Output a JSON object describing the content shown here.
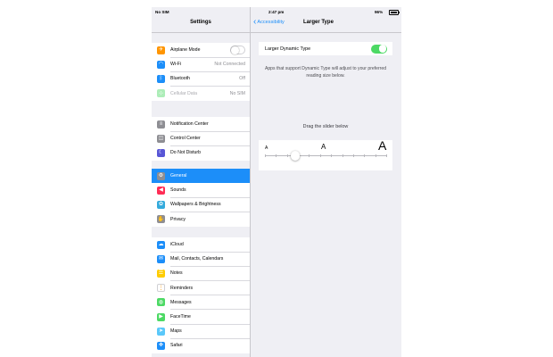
{
  "status_bar": {
    "carrier": "No SIM",
    "time": "2:47 pm",
    "battery": "96%"
  },
  "sidebar": {
    "title": "Settings",
    "groups": [
      [
        {
          "label": "Airplane Mode",
          "icon": "airplane-icon",
          "color": "#ff9500",
          "glyph": "✈",
          "toggle": false
        },
        {
          "label": "Wi-Fi",
          "value": "Not Connected",
          "icon": "wifi-icon",
          "color": "#1c8ef9",
          "glyph": "◠"
        },
        {
          "label": "Bluetooth",
          "value": "Off",
          "icon": "bluetooth-icon",
          "color": "#1c8ef9",
          "glyph": "ᛒ"
        },
        {
          "label": "Cellular Data",
          "value": "No SIM",
          "icon": "cellular-icon",
          "color": "#4cd964",
          "glyph": "⊹",
          "disabled": true
        }
      ],
      [
        {
          "label": "Notification Center",
          "icon": "notification-center-icon",
          "color": "#8e8e93",
          "glyph": "≡"
        },
        {
          "label": "Control Center",
          "icon": "control-center-icon",
          "color": "#8e8e93",
          "glyph": "◫"
        },
        {
          "label": "Do Not Disturb",
          "icon": "moon-icon",
          "color": "#5856d6",
          "glyph": "☾"
        }
      ],
      [
        {
          "label": "General",
          "icon": "gear-icon",
          "color": "#8e8e93",
          "glyph": "⚙",
          "selected": true
        },
        {
          "label": "Sounds",
          "icon": "speaker-icon",
          "color": "#ff2d55",
          "glyph": "◀"
        },
        {
          "label": "Wallpapers & Brightness",
          "icon": "flower-icon",
          "color": "#34aadc",
          "glyph": "✿"
        },
        {
          "label": "Privacy",
          "icon": "hand-icon",
          "color": "#8e8e93",
          "glyph": "✋"
        }
      ],
      [
        {
          "label": "iCloud",
          "icon": "cloud-icon",
          "color": "#1c8ef9",
          "glyph": "☁"
        },
        {
          "label": "Mail, Contacts, Calendars",
          "icon": "mail-icon",
          "color": "#1c8ef9",
          "glyph": "✉"
        },
        {
          "label": "Notes",
          "icon": "notes-icon",
          "color": "#ffcc00",
          "glyph": "☰"
        },
        {
          "label": "Reminders",
          "icon": "reminders-icon",
          "color": "#ffffff",
          "glyph": "⋮"
        },
        {
          "label": "Messages",
          "icon": "messages-icon",
          "color": "#4cd964",
          "glyph": "◍"
        },
        {
          "label": "FaceTime",
          "icon": "facetime-icon",
          "color": "#4cd964",
          "glyph": "▶"
        },
        {
          "label": "Maps",
          "icon": "maps-icon",
          "color": "#5ac8fa",
          "glyph": "➤"
        },
        {
          "label": "Safari",
          "icon": "safari-icon",
          "color": "#1c8ef9",
          "glyph": "✥"
        }
      ]
    ]
  },
  "detail": {
    "back_label": "Accessibility",
    "title": "Larger Type",
    "toggle_label": "Larger Dynamic Type",
    "toggle_on": true,
    "description": "Apps that support Dynamic Type will adjust to your preferred reading size below.",
    "slider_caption": "Drag the slider below",
    "slider": {
      "small_label": "A",
      "mid_label": "A",
      "large_label": "A",
      "level": 0.25,
      "ticks": 12
    }
  },
  "colors": {
    "accent": "#1c8ef9",
    "toggle_on": "#4cd964",
    "background": "#efeff4"
  }
}
